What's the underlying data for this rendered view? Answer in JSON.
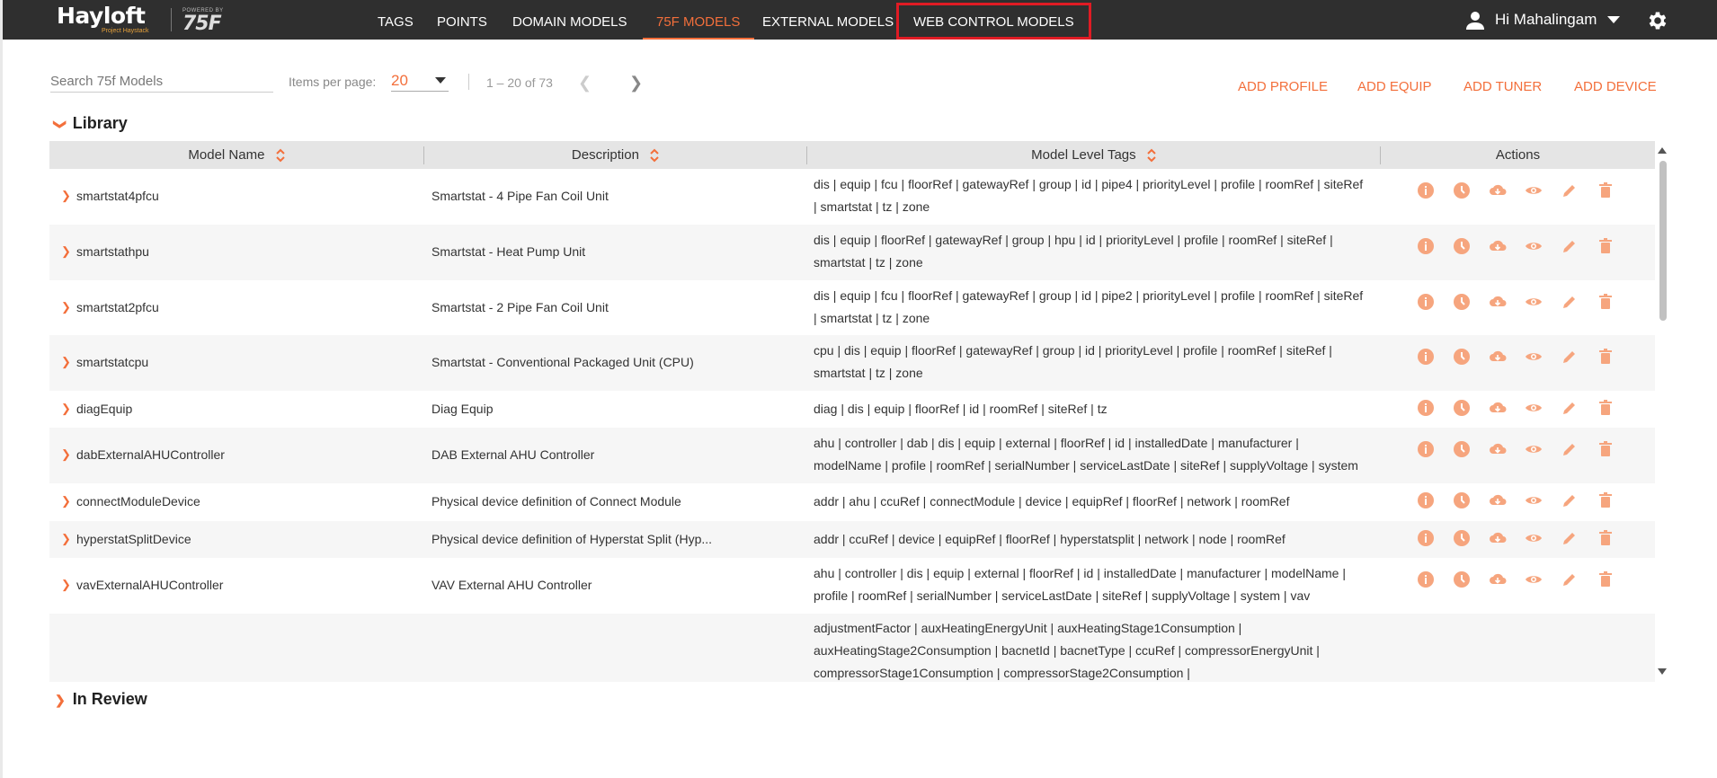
{
  "brand": {
    "logo": "Hayloft",
    "logo_sub": "Project Haystack",
    "powered_by": "POWERED BY",
    "powered_logo": "75F"
  },
  "nav": {
    "tags": "TAGS",
    "points": "POINTS",
    "domain_models": "DOMAIN MODELS",
    "models_75f": "75F MODELS",
    "external_models": "EXTERNAL MODELS",
    "web_control_models": "WEB CONTROL MODELS"
  },
  "user": {
    "greeting": "Hi Mahalingam"
  },
  "toolbar": {
    "search_placeholder": "Search 75f Models",
    "items_per_page_label": "Items per page:",
    "items_per_page_value": "20",
    "range": "1 – 20 of 73",
    "add_profile": "ADD PROFILE",
    "add_equip": "ADD EQUIP",
    "add_tuner": "ADD TUNER",
    "add_device": "ADD DEVICE"
  },
  "sections": {
    "library": "Library",
    "in_review": "In Review"
  },
  "table": {
    "headers": {
      "model_name": "Model Name",
      "description": "Description",
      "model_level_tags": "Model Level Tags",
      "actions": "Actions"
    },
    "rows": [
      {
        "name": "smartstat4pfcu",
        "description": "Smartstat - 4 Pipe Fan Coil Unit",
        "tags_line1": "dis | equip | fcu | floorRef | gatewayRef | group | id | pipe4 | priorityLevel | profile | roomRef | siteRef",
        "tags_line2": "| smartstat | tz | zone",
        "tags_line3": ""
      },
      {
        "name": "smartstathpu",
        "description": "Smartstat - Heat Pump Unit",
        "tags_line1": "dis | equip | floorRef | gatewayRef | group | hpu | id | priorityLevel | profile | roomRef | siteRef |",
        "tags_line2": "smartstat | tz | zone",
        "tags_line3": ""
      },
      {
        "name": "smartstat2pfcu",
        "description": "Smartstat - 2 Pipe Fan Coil Unit",
        "tags_line1": "dis | equip | fcu | floorRef | gatewayRef | group | id | pipe2 | priorityLevel | profile | roomRef | siteRef",
        "tags_line2": "| smartstat | tz | zone",
        "tags_line3": ""
      },
      {
        "name": "smartstatcpu",
        "description": "Smartstat - Conventional Packaged Unit (CPU)",
        "tags_line1": "cpu | dis | equip | floorRef | gatewayRef | group | id | priorityLevel | profile | roomRef | siteRef |",
        "tags_line2": "smartstat | tz | zone",
        "tags_line3": ""
      },
      {
        "name": "diagEquip",
        "description": "Diag Equip",
        "tags_line1": "diag | dis | equip | floorRef | id | roomRef | siteRef | tz",
        "tags_line2": "",
        "tags_line3": ""
      },
      {
        "name": "dabExternalAHUController",
        "description": "DAB External AHU Controller",
        "tags_line1": "ahu | controller | dab | dis | equip | external | floorRef | id | installedDate | manufacturer |",
        "tags_line2": "modelName | profile | roomRef | serialNumber | serviceLastDate | siteRef | supplyVoltage | system",
        "tags_line3": ""
      },
      {
        "name": "connectModuleDevice",
        "description": "Physical device definition of Connect Module",
        "tags_line1": "addr | ahu | ccuRef | connectModule | device | equipRef | floorRef | network | roomRef",
        "tags_line2": "",
        "tags_line3": ""
      },
      {
        "name": "hyperstatSplitDevice",
        "description": "Physical device definition of Hyperstat Split (Hyp...",
        "tags_line1": "addr | ccuRef | device | equipRef | floorRef | hyperstatsplit | network | node | roomRef",
        "tags_line2": "",
        "tags_line3": ""
      },
      {
        "name": "vavExternalAHUController",
        "description": "VAV External AHU Controller",
        "tags_line1": "ahu | controller | dis | equip | external | floorRef | id | installedDate | manufacturer | modelName |",
        "tags_line2": "profile | roomRef | serialNumber | serviceLastDate | siteRef | supplyVoltage | system | vav",
        "tags_line3": ""
      },
      {
        "name": "",
        "description": "",
        "tags_line1": "adjustmentFactor | auxHeatingEnergyUnit | auxHeatingStage1Consumption |",
        "tags_line2": "auxHeatingStage2Consumption | bacnetId | bacnetType | ccuRef | compressorEnergyUnit |",
        "tags_line3": "compressorStage1Consumption | compressorStage2Consumption |"
      }
    ]
  },
  "colors": {
    "accent": "#f36f3b",
    "nav_bg": "#2f2f2f",
    "highlight_box": "#e01b24",
    "action_icon": "#f6a57e"
  }
}
